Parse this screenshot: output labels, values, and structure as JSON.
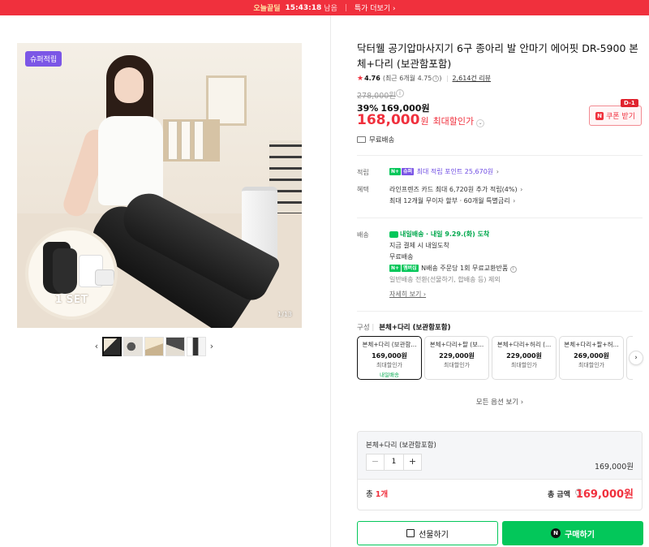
{
  "top_banner": {
    "title": "오늘끝딜",
    "timer": "15:43:18",
    "remain": "남음",
    "more": "특가 더보기 ›"
  },
  "gallery": {
    "badge": "슈퍼적립",
    "inset_label": "1 SET",
    "page_counter": "1/13",
    "prev": "‹",
    "next": "›",
    "thumb_count": 5,
    "active_thumb": 1
  },
  "product": {
    "title": "닥터웰 공기압마사지기 6구 종아리 발 안마기 에어핏 DR-5900 본체+다리 (보관함포함)",
    "rating": "4.76",
    "rating_recent": "(최근 6개월 4.75",
    "rating_recent_close": ")",
    "reviews": "2,614건 리뷰"
  },
  "price": {
    "original": "278,000원",
    "discount_pct": "39%",
    "discount_price": "169,000원",
    "max_price": "168,000",
    "won": "원",
    "max_label": "최대할인가",
    "coupon_label": "쿠폰 받기",
    "coupon_tag": "D-1",
    "shipping": "무료배송"
  },
  "benefits": {
    "point_label": "적립",
    "point_text": "최대 적립 포인트 25,670원",
    "benefit_label": "혜택",
    "benefit_line1": "라인프렌즈 카드 최대 6,720원 추가 적립(4%)",
    "benefit_line2": "최대 12개월 무이자 할부 · 60개월 특별금리"
  },
  "delivery": {
    "label": "배송",
    "tag": "내일배송",
    "date": "· 내일 9.29.(화) 도착",
    "line1": "지금 결제 시 내일도착",
    "line2": "무료배송",
    "line3": "N배송 주문당 1회 무료교환반품",
    "line4": "일반배송 전환(선물하기, 합배송 등) 제외",
    "details": "자세히 보기 ›"
  },
  "options": {
    "label": "구성",
    "selected": "본체+다리 (보관함포함)",
    "cards": [
      {
        "name": "본체+다리 (보관함...",
        "price": "169,000원",
        "sub": "최대할인가",
        "deliv": "내일배송"
      },
      {
        "name": "본체+다리+팔 (보...",
        "price": "229,000원",
        "sub": "최대할인가",
        "deliv": ""
      },
      {
        "name": "본체+다리+허리 (...",
        "price": "229,000원",
        "sub": "최대할인가",
        "deliv": ""
      },
      {
        "name": "본체+다리+팔+허...",
        "price": "269,000원",
        "sub": "최대할인가",
        "deliv": ""
      },
      {
        "name": "본",
        "price": "",
        "sub": "",
        "deliv": ""
      }
    ],
    "all_options": "모든 옵션 보기 ›"
  },
  "order": {
    "item_name": "본체+다리 (보관함포함)",
    "quantity": "1",
    "minus": "−",
    "plus": "+",
    "line_price": "169,000원",
    "total_count_prefix": "총 ",
    "total_count": "1개",
    "total_label": "총 금액",
    "total_price": "169,000원"
  },
  "actions": {
    "gift": "선물하기",
    "buy": "구매하기"
  },
  "colors": {
    "accent_red": "#f0303d",
    "naver_green": "#03c75a",
    "point_purple": "#7b56e6"
  }
}
